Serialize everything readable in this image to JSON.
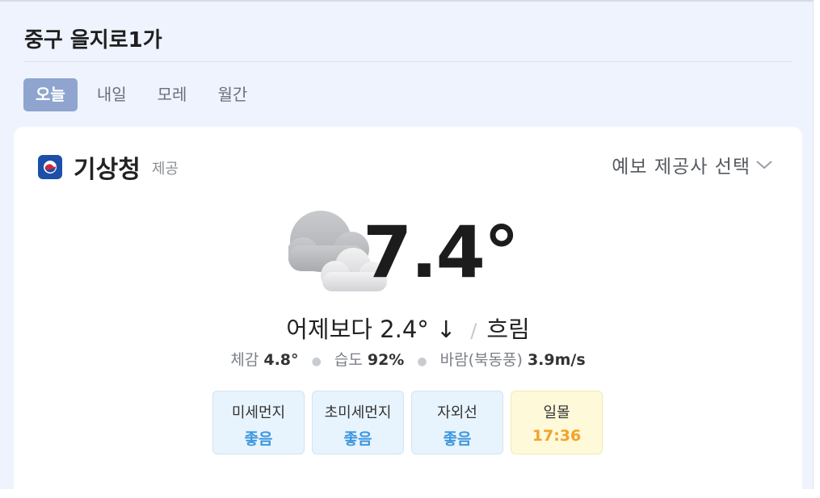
{
  "location": "중구 을지로1가",
  "tabs": [
    {
      "label": "오늘",
      "active": true
    },
    {
      "label": "내일",
      "active": false
    },
    {
      "label": "모레",
      "active": false
    },
    {
      "label": "월간",
      "active": false
    }
  ],
  "provider": {
    "name": "기상청",
    "suffix": "제공",
    "logo_icon": "kma-logo-icon"
  },
  "forecast_selector": {
    "label": "예보 제공사 선택",
    "icon": "chevron-down-icon"
  },
  "current": {
    "icon": "cloudy-icon",
    "temperature": "7.4°",
    "compare_text": "어제보다 2.4° ↓",
    "separator": "/",
    "condition": "흐림"
  },
  "details": {
    "feels_like_label": "체감",
    "feels_like_value": "4.8°",
    "humidity_label": "습도",
    "humidity_value": "92%",
    "wind_label": "바람(북동풍)",
    "wind_value": "3.9m/s"
  },
  "indicators": [
    {
      "label": "미세먼지",
      "value": "좋음"
    },
    {
      "label": "초미세먼지",
      "value": "좋음"
    },
    {
      "label": "자외선",
      "value": "좋음"
    },
    {
      "label": "일몰",
      "value": "17:36"
    }
  ],
  "colors": {
    "background": "#eef3fd",
    "tab_active": "#8fa5cf",
    "good_status": "#3d97e0",
    "sunset_value": "#f3a22a",
    "sunset_bg": "#fdf9d9",
    "badge_bg": "#e8f4fd"
  }
}
